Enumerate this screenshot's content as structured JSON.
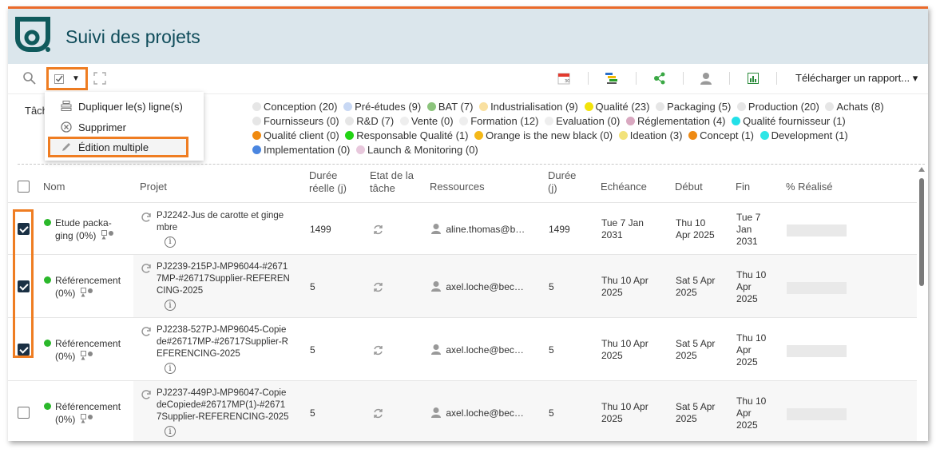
{
  "app": {
    "title": "Suivi des projets",
    "accent_color": "#ef7d22",
    "header_bg": "#dbe6ec",
    "logo_color": "#0f5a5c"
  },
  "toolbar": {
    "search_icon": "search-icon",
    "select_icon": "checkbox-select-icon",
    "dropdown_caret": "▼",
    "expand_icon": "expand-icon",
    "right_icons": [
      "calendar-icon",
      "gantt-icon",
      "tree-icon",
      "user-icon",
      "spreadsheet-icon"
    ],
    "report_label": "Télécharger un rapport... ▾"
  },
  "menu": {
    "items": [
      {
        "label": "Dupliquer le(s) ligne(s)",
        "icon": "duplicate-icon"
      },
      {
        "label": "Supprimer",
        "icon": "delete-circle-icon"
      },
      {
        "label": "Édition multiple",
        "icon": "pencil-icon"
      }
    ]
  },
  "filters": {
    "label_partial": "Tâch",
    "chips": [
      {
        "label": "Conception (20)",
        "color": "#e6e6e6"
      },
      {
        "label": "Pré-études (9)",
        "color": "#c8d8f4"
      },
      {
        "label": "BAT (7)",
        "color": "#8cc47c"
      },
      {
        "label": "Industrialisation (9)",
        "color": "#f9e0a0"
      },
      {
        "label": "Qualité (23)",
        "color": "#f2e30a"
      },
      {
        "label": "Packaging (5)",
        "color": "#e6e6e6"
      },
      {
        "label": "Production (20)",
        "color": "#e6e6e6"
      },
      {
        "label": "Achats (8)",
        "color": "#e6e6e6"
      },
      {
        "label": "Fournisseurs (0)",
        "color": "#e6e6e6"
      },
      {
        "label": "R&D (7)",
        "color": "#e6e6e6"
      },
      {
        "label": "Vente (0)",
        "color": "#eeeeee"
      },
      {
        "label": "Formation (12)",
        "color": "#eeeeee"
      },
      {
        "label": "Evaluation (0)",
        "color": "#eeeeee"
      },
      {
        "label": "Réglementation (4)",
        "color": "#d9a8c0"
      },
      {
        "label": "Qualité fournisseur (1)",
        "color": "#22e0e8"
      },
      {
        "label": "Qualité client (0)",
        "color": "#f08a10"
      },
      {
        "label": "Responsable Qualité (1)",
        "color": "#22d414"
      },
      {
        "label": "Orange is the new black (0)",
        "color": "#f4b818"
      },
      {
        "label": "Ideation (3)",
        "color": "#f2e27a"
      },
      {
        "label": "Concept (1)",
        "color": "#ee8a14"
      },
      {
        "label": "Development (1)",
        "color": "#2ee6e6"
      },
      {
        "label": "Implementation (0)",
        "color": "#4a86e0"
      },
      {
        "label": "Launch & Monitoring (0)",
        "color": "#e8c8dc"
      }
    ]
  },
  "table": {
    "headers": {
      "nom": "Nom",
      "projet": "Projet",
      "duree_reelle_1": "Durée",
      "duree_reelle_2": "réelle (j)",
      "etat_1": "Etat de la",
      "etat_2": "tâche",
      "ressources": "Ressources",
      "duree_1": "Durée",
      "duree_2": "(j)",
      "echeance": "Echéance",
      "debut": "Début",
      "fin": "Fin",
      "realise": "% Réalisé"
    },
    "rows": [
      {
        "checked": true,
        "nom_1": "Etude packa-",
        "nom_2": "ging (0%)",
        "projet": [
          "PJ2242-Jus de carotte et ginge",
          "mbre"
        ],
        "duree_reelle": "1499",
        "ressource": "aline.thomas@b…",
        "duree": "1499",
        "echeance": [
          "Tue 7 Jan",
          "2031"
        ],
        "debut": [
          "Thu 10",
          "Apr 2025"
        ],
        "fin": [
          "Tue 7",
          "Jan",
          "2031"
        ]
      },
      {
        "checked": true,
        "nom_1": "Référencement",
        "nom_2": "(0%)",
        "projet": [
          "PJ2239-215PJ-MP96044-#2671",
          "7MP-#26717Supplier-REFEREN",
          "CING-2025"
        ],
        "duree_reelle": "5",
        "ressource": "axel.loche@bec…",
        "duree": "5",
        "echeance": [
          "Thu 10 Apr",
          "2025"
        ],
        "debut": [
          "Sat 5 Apr",
          "2025"
        ],
        "fin": [
          "Thu 10",
          "Apr",
          "2025"
        ]
      },
      {
        "checked": true,
        "nom_1": "Référencement",
        "nom_2": "(0%)",
        "projet": [
          "PJ2238-527PJ-MP96045-Copie",
          "de#26717MP-#26717Supplier-R",
          "EFERENCING-2025"
        ],
        "duree_reelle": "5",
        "ressource": "axel.loche@bec…",
        "duree": "5",
        "echeance": [
          "Thu 10 Apr",
          "2025"
        ],
        "debut": [
          "Sat 5 Apr",
          "2025"
        ],
        "fin": [
          "Thu 10",
          "Apr",
          "2025"
        ]
      },
      {
        "checked": false,
        "nom_1": "Référencement",
        "nom_2": "(0%)",
        "projet": [
          "PJ2237-449PJ-MP96047-Copie",
          "deCopiede#26717MP(1)-#2671",
          "7Supplier-REFERENCING-2025"
        ],
        "duree_reelle": "5",
        "ressource": "axel.loche@bec…",
        "duree": "5",
        "echeance": [
          "Thu 10 Apr",
          "2025"
        ],
        "debut": [
          "Sat 5 Apr",
          "2025"
        ],
        "fin": [
          "Thu 10",
          "Apr",
          "2025"
        ]
      }
    ]
  }
}
